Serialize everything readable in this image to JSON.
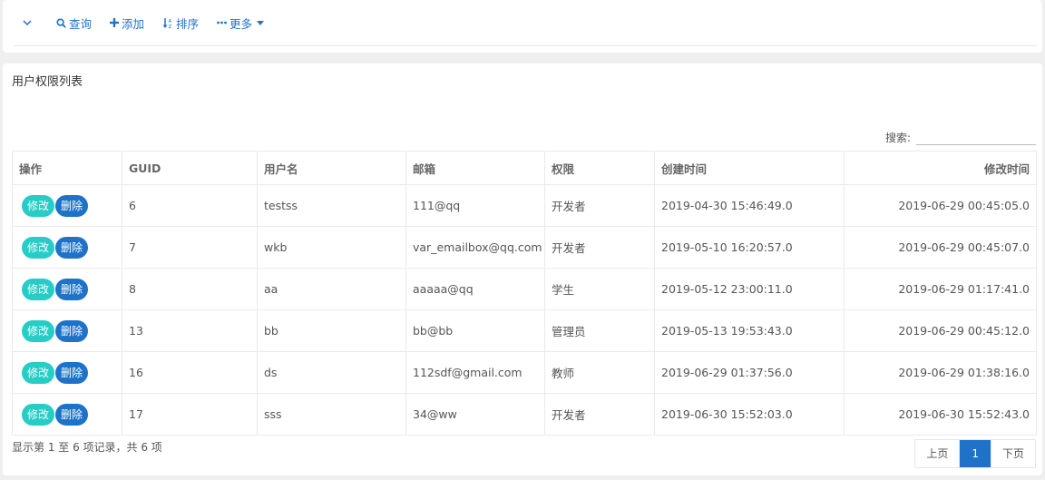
{
  "toolbar": {
    "query_label": "查询",
    "add_label": "添加",
    "sort_label": "排序",
    "more_label": "更多"
  },
  "panel": {
    "title": "用户权限列表",
    "search_label": "搜索:",
    "search_value": ""
  },
  "table": {
    "headers": [
      "操作",
      "GUID",
      "用户名",
      "邮箱",
      "权限",
      "创建时间",
      "修改时间"
    ],
    "edit_label": "修改",
    "delete_label": "删除",
    "rows": [
      {
        "guid": "6",
        "username": "testss",
        "email": "111@qq",
        "role": "开发者",
        "created": "2019-04-30 15:46:49.0",
        "modified": "2019-06-29 00:45:05.0"
      },
      {
        "guid": "7",
        "username": "wkb",
        "email": "var_emailbox@qq.com",
        "role": "开发者",
        "created": "2019-05-10 16:20:57.0",
        "modified": "2019-06-29 00:45:07.0"
      },
      {
        "guid": "8",
        "username": "aa",
        "email": "aaaaa@qq",
        "role": "学生",
        "created": "2019-05-12 23:00:11.0",
        "modified": "2019-06-29 01:17:41.0"
      },
      {
        "guid": "13",
        "username": "bb",
        "email": "bb@bb",
        "role": "管理员",
        "created": "2019-05-13 19:53:43.0",
        "modified": "2019-06-29 00:45:12.0"
      },
      {
        "guid": "16",
        "username": "ds",
        "email": "112sdf@gmail.com",
        "role": "教师",
        "created": "2019-06-29 01:37:56.0",
        "modified": "2019-06-29 01:38:16.0"
      },
      {
        "guid": "17",
        "username": "sss",
        "email": "34@ww",
        "role": "开发者",
        "created": "2019-06-30 15:52:03.0",
        "modified": "2019-06-30 15:52:43.0"
      }
    ]
  },
  "footer": {
    "info": "显示第 1 至 6 项记录，共 6 项",
    "prev_label": "上页",
    "page_label": "1",
    "next_label": "下页"
  },
  "colors": {
    "accent": "#1e73c9",
    "edit": "#26cdc6"
  }
}
